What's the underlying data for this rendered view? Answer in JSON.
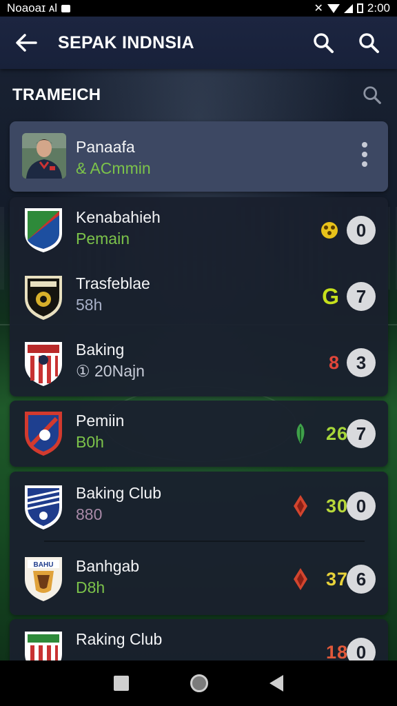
{
  "status_bar": {
    "left_text": "Nᴏaoaɪ ᴀl",
    "time": "2:00"
  },
  "app_bar": {
    "title": "SEPAK INDNSIA"
  },
  "section": {
    "title": "TRAMEICH"
  },
  "featured": {
    "name": "Panaafa",
    "subtitle": "& ACmmin"
  },
  "teams": [
    {
      "name": "Kenabahieh",
      "sub": "Pemain",
      "sub_color": "#7cc34a",
      "score": "",
      "score_color": "#e8c21a",
      "badge": "0",
      "icon": "crown-icon"
    },
    {
      "name": "Trasfeblae",
      "sub": "58h",
      "sub_color": "#a8b0c8",
      "score": "G",
      "score_color": "#c6e01c",
      "badge": "7",
      "icon": ""
    },
    {
      "name": "Baking",
      "sub": "① 20Najn",
      "sub_color": "#c7ccd8",
      "score": "8",
      "score_color": "#e0463a",
      "badge": "3",
      "icon": ""
    },
    {
      "name": "Pemiin",
      "sub": "B0h",
      "sub_color": "#7cc34a",
      "score": "26",
      "score_color": "#a6d63a",
      "badge": "7",
      "icon": "leaf-icon"
    },
    {
      "name": "Baking Club",
      "sub": "880",
      "sub_color": "#a98aa8",
      "score": "30",
      "score_color": "#b8d83a",
      "badge": "0",
      "icon": "flame-icon"
    },
    {
      "name": "Banhgab",
      "sub": "D8h",
      "sub_color": "#7cc34a",
      "score": "37",
      "score_color": "#e8d23a",
      "badge": "6",
      "icon": "flame-icon"
    },
    {
      "name": "Raking Club",
      "sub": "",
      "sub_color": "#7cc34a",
      "score": "18",
      "score_color": "#e0583a",
      "badge": "0",
      "icon": ""
    }
  ],
  "colors": {
    "accent": "#7cc34a",
    "card": "#1a202e",
    "highlight": "#3d4863"
  }
}
